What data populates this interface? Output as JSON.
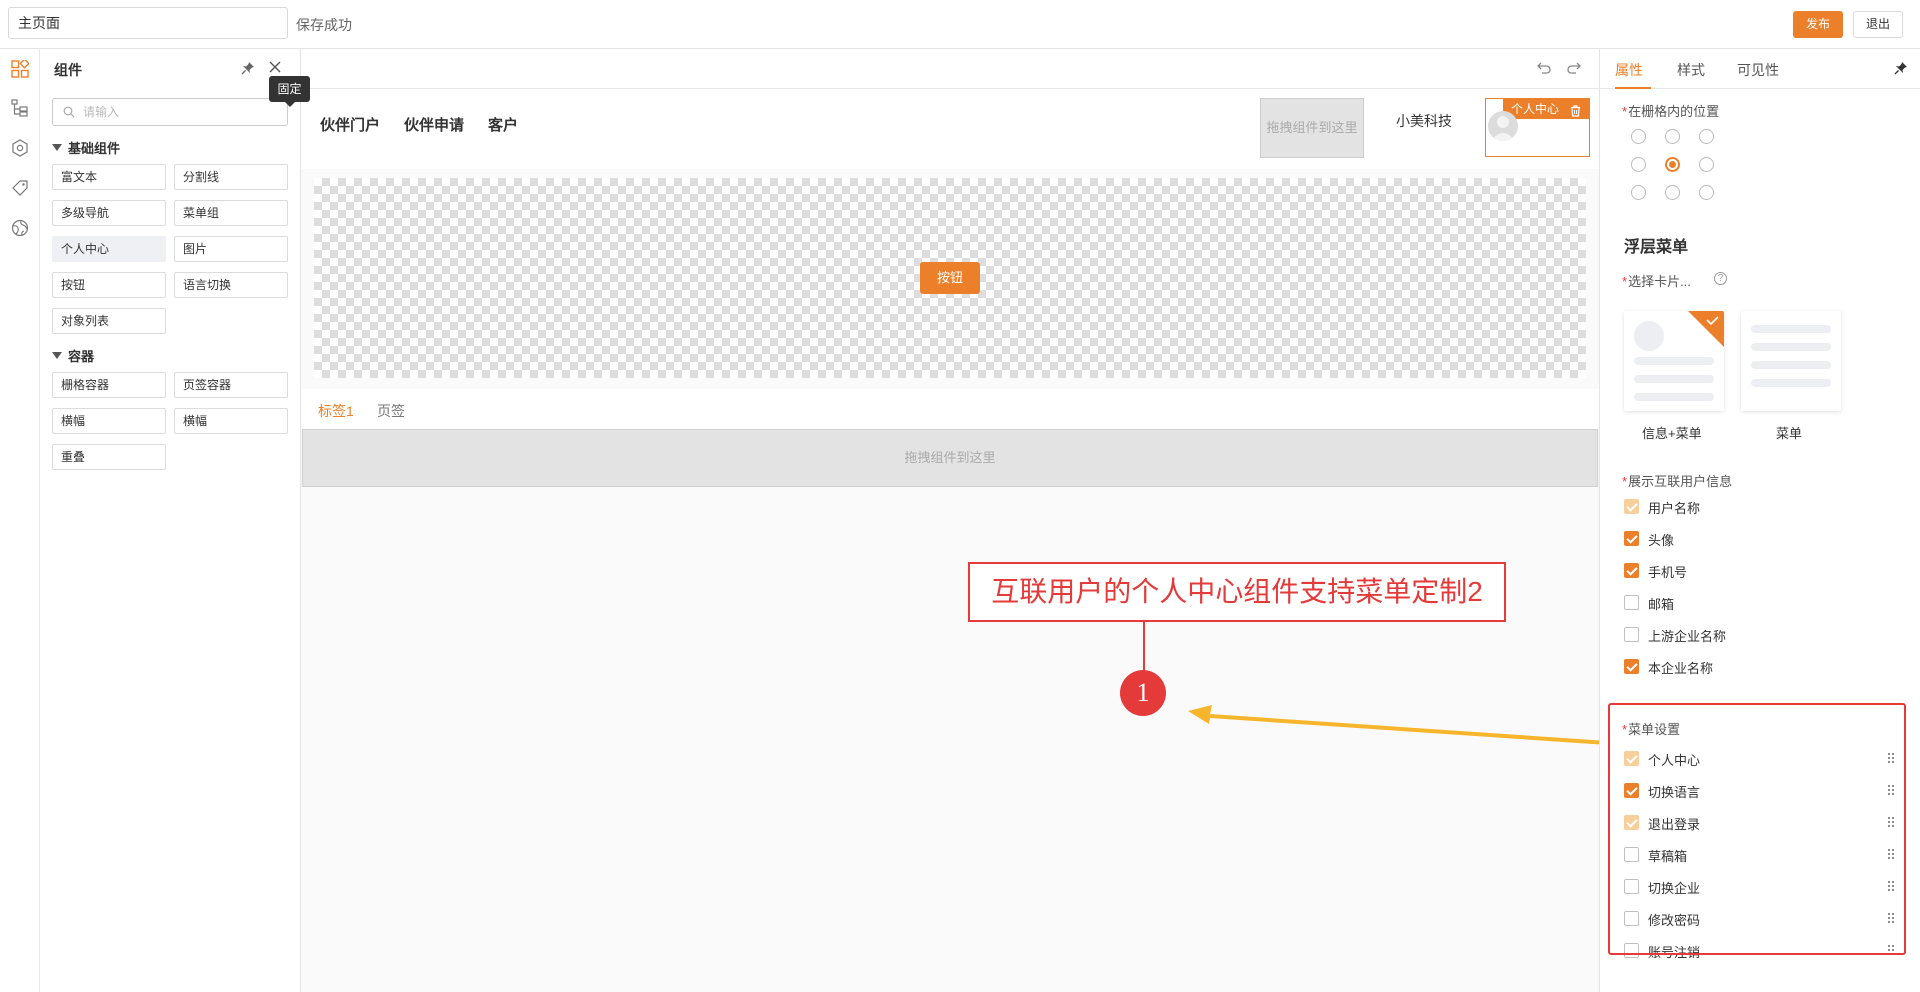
{
  "topbar": {
    "page_name": "主页面",
    "save_status": "保存成功",
    "publish_label": "发布",
    "exit_label": "退出"
  },
  "rail": {
    "icons": [
      "components-icon",
      "tree-icon",
      "settings-icon",
      "tag-icon",
      "globe-icon"
    ]
  },
  "components": {
    "title": "组件",
    "pin_tooltip": "固定",
    "search_placeholder": "请输入",
    "basic_title": "基础组件",
    "basic": [
      "富文本",
      "分割线",
      "多级导航",
      "菜单组",
      "个人中心",
      "图片",
      "按钮",
      "语言切换",
      "对象列表"
    ],
    "container_title": "容器",
    "containers": [
      "栅格容器",
      "页签容器",
      "横幅",
      "横幅",
      "重叠"
    ]
  },
  "canvas": {
    "nav": [
      "伙伴门户",
      "伙伴申请",
      "客户"
    ],
    "drop_small": "拖拽组件到这里",
    "company": "小美科技",
    "uc_tag": "个人中心",
    "button_label": "按钮",
    "tabs": [
      "标签1",
      "页签"
    ],
    "drop_wide": "拖拽组件到这里"
  },
  "annotation": {
    "text": "互联用户的个人中心组件支持菜单定制2",
    "number": "1",
    "color": "#e43a3a",
    "arrow_color": "#f7b52c"
  },
  "props": {
    "tabs": [
      "属性",
      "样式",
      "可见性"
    ],
    "grid_position_label": "在栅格内的位置",
    "grid_selected": "middle-center",
    "layer_menu_title": "浮层菜单",
    "select_card_label": "选择卡片...",
    "cards": [
      "信息+菜单",
      "菜单"
    ],
    "selected_card": "信息+菜单",
    "show_user_info_label": "展示互联用户信息",
    "user_info": [
      {
        "label": "用户名称",
        "state": "disabled-checked"
      },
      {
        "label": "头像",
        "state": "checked"
      },
      {
        "label": "手机号",
        "state": "checked"
      },
      {
        "label": "邮箱",
        "state": "unchecked"
      },
      {
        "label": "上游企业名称",
        "state": "unchecked"
      },
      {
        "label": "本企业名称",
        "state": "checked"
      }
    ],
    "menu_settings_label": "菜单设置",
    "menu_items": [
      {
        "label": "个人中心",
        "state": "disabled-checked"
      },
      {
        "label": "切换语言",
        "state": "checked"
      },
      {
        "label": "退出登录",
        "state": "disabled-checked"
      },
      {
        "label": "草稿箱",
        "state": "unchecked"
      },
      {
        "label": "切换企业",
        "state": "unchecked"
      },
      {
        "label": "修改密码",
        "state": "unchecked"
      },
      {
        "label": "账号注销",
        "state": "unchecked"
      }
    ]
  },
  "colors": {
    "accent": "#ec7f2a"
  }
}
